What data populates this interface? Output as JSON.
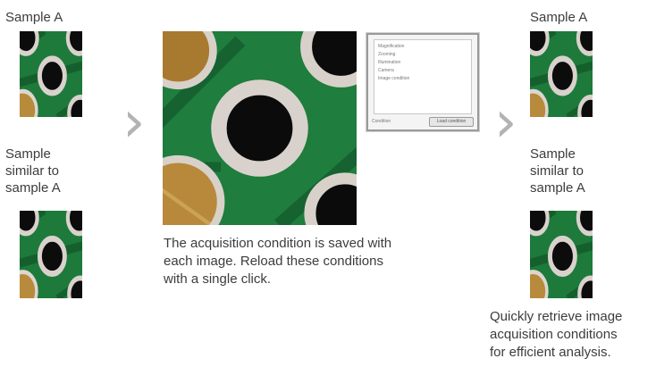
{
  "left": {
    "sample_a_label": "Sample A",
    "similar_label_line1": "Sample",
    "similar_label_line2": "similar to",
    "similar_label_line3": "sample A"
  },
  "center": {
    "caption_line1": "The acquisition condition is saved with",
    "caption_line2": "each image. Reload these conditions",
    "caption_line3": "with a single click."
  },
  "dialog": {
    "items": [
      "Magnification",
      "Zooming",
      "Illumination",
      "Camera",
      "Image condition"
    ],
    "bar_label": "Condition",
    "button_label": "Load condition"
  },
  "right": {
    "sample_a_label": "Sample A",
    "similar_label_line1": "Sample",
    "similar_label_line2": "similar to",
    "similar_label_line3": "sample A",
    "caption_line1": "Quickly retrieve image",
    "caption_line2": "acquisition conditions",
    "caption_line3": "for efficient analysis."
  },
  "arrows": {
    "glyph": "›"
  },
  "colors": {
    "pcb_green": "#1e7a3a",
    "pad_ring": "#d9d2cc",
    "gold": "#b88a3c",
    "arrow": "#b3b3b3"
  }
}
